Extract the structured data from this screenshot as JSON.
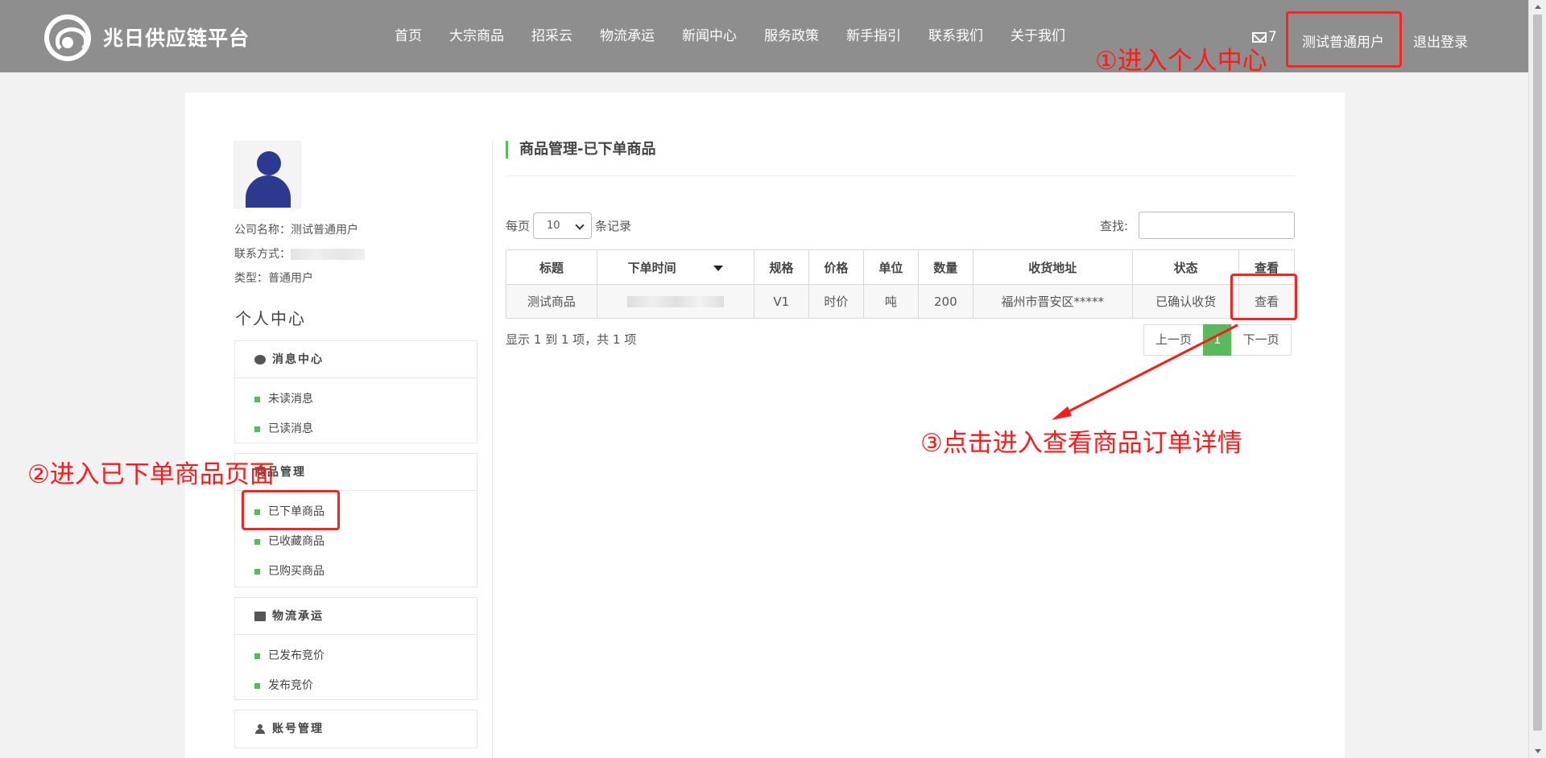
{
  "header": {
    "brand": "兆日供应链平台",
    "nav": [
      "首页",
      "大宗商品",
      "招采云",
      "物流承运",
      "新闻中心",
      "服务政策",
      "新手指引",
      "联系我们",
      "关于我们"
    ],
    "mail_count": "7",
    "user_name": "测试普通用户",
    "logout": "退出登录"
  },
  "sidebar": {
    "company_line": "公司名称：测试普通用户",
    "contact_label": "联系方式：",
    "type_line": "类型：普通用户",
    "section_title": "个人中心",
    "panels": [
      {
        "title": "消息中心",
        "icon": "chat-icon",
        "items": [
          "未读消息",
          "已读消息"
        ]
      },
      {
        "title": "商品管理",
        "icon": "",
        "items": [
          "已下单商品",
          "已收藏商品",
          "已购买商品"
        ]
      },
      {
        "title": "物流承运",
        "icon": "truck-icon",
        "items": [
          "已发布竞价",
          "发布竞价"
        ]
      },
      {
        "title": "账号管理",
        "icon": "user-icon",
        "items": []
      }
    ]
  },
  "content": {
    "title": "商品管理-已下单商品",
    "per_page_prefix": "每页",
    "per_page_value": "10",
    "per_page_suffix": "条记录",
    "search_label": "查找:",
    "columns": [
      "标题",
      "下单时间",
      "规格",
      "价格",
      "单位",
      "数量",
      "收货地址",
      "状态",
      "查看"
    ],
    "rows": [
      {
        "title": "测试商品",
        "spec": "V1",
        "price": "时价",
        "unit": "吨",
        "qty": "200",
        "address": "福州市晋安区*****",
        "status": "已确认收货",
        "action": "查看"
      }
    ],
    "summary": "显示 1 到 1 项，共 1 项",
    "pager": {
      "prev": "上一页",
      "current": "1",
      "next": "下一页"
    }
  },
  "annotations": {
    "step1": "①进入个人中心",
    "step2": "②进入已下单商品页面",
    "step3": "③点击进入查看商品订单详情",
    "color": "#ff1a1a"
  },
  "colors": {
    "header_bg": "#8e8e8e",
    "accent_green": "#5cb85c"
  }
}
